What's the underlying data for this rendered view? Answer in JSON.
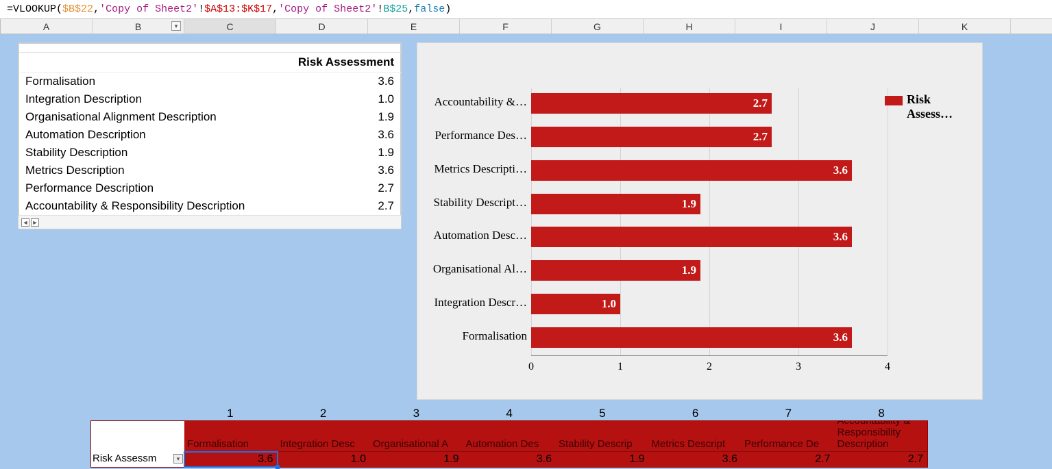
{
  "formula": {
    "eq": "=",
    "fn": "VLOOKUP",
    "open": "(",
    "ref1": "$B$22",
    "c1": ",",
    "sheet1a": "'Copy of Sheet2'",
    "bang1": "!",
    "ref2": "$A$13:$K$17",
    "c2": ",",
    "sheet1b": "'Copy of Sheet2'",
    "bang2": "!",
    "ref3": "B$25",
    "c3": ",",
    "kw": "false",
    "close": ")"
  },
  "columns": [
    "A",
    "B",
    "C",
    "D",
    "E",
    "F",
    "G",
    "H",
    "I",
    "J",
    "K"
  ],
  "selected_col_index": 2,
  "dropdown_col_index": 1,
  "card": {
    "title": "Risk Assessment",
    "rows": [
      {
        "label": "Formalisation",
        "value": "3.6"
      },
      {
        "label": "Integration Description",
        "value": "1.0"
      },
      {
        "label": "Organisational Alignment Description",
        "value": "1.9"
      },
      {
        "label": "Automation Description",
        "value": "3.6"
      },
      {
        "label": "Stability Description",
        "value": "1.9"
      },
      {
        "label": "Metrics Description",
        "value": "3.6"
      },
      {
        "label": "Performance Description",
        "value": "2.7"
      },
      {
        "label": "Accountability & Responsibility Description",
        "value": "2.7"
      }
    ],
    "left_arrow": "◄",
    "right_arrow": "►"
  },
  "legend_line1": "Risk",
  "legend_line2": "Assess…",
  "chart_data": {
    "type": "bar",
    "orientation": "horizontal",
    "title": "",
    "xlabel": "",
    "ylabel": "",
    "xlim": [
      0,
      4
    ],
    "xticks": [
      0,
      1,
      2,
      3,
      4
    ],
    "legend": [
      "Risk Assessment"
    ],
    "categories": [
      "Accountability &…",
      "Performance Des…",
      "Metrics Descripti…",
      "Stability Descript…",
      "Automation Desc…",
      "Organisational Al…",
      "Integration Descr…",
      "Formalisation"
    ],
    "values": [
      2.7,
      2.7,
      3.6,
      1.9,
      3.6,
      1.9,
      1.0,
      3.6
    ],
    "color": "#c21919"
  },
  "bottom": {
    "nums": [
      "1",
      "2",
      "3",
      "4",
      "5",
      "6",
      "7",
      "8"
    ],
    "rowhead_blank": "",
    "rowhead_label": "Risk Assessm",
    "cols": [
      {
        "label": "Formalisation",
        "value": "3.6"
      },
      {
        "label": "Integration Desc",
        "value": "1.0"
      },
      {
        "label": "Organisational A",
        "value": "1.9"
      },
      {
        "label": "Automation Des",
        "value": "3.6"
      },
      {
        "label": "Stability Descrip",
        "value": "1.9"
      },
      {
        "label": "Metrics Descript",
        "value": "3.6"
      },
      {
        "label": "Performance De",
        "value": "2.7"
      },
      {
        "label": "Accountability & Responsibility Description",
        "value": "2.7"
      }
    ]
  }
}
